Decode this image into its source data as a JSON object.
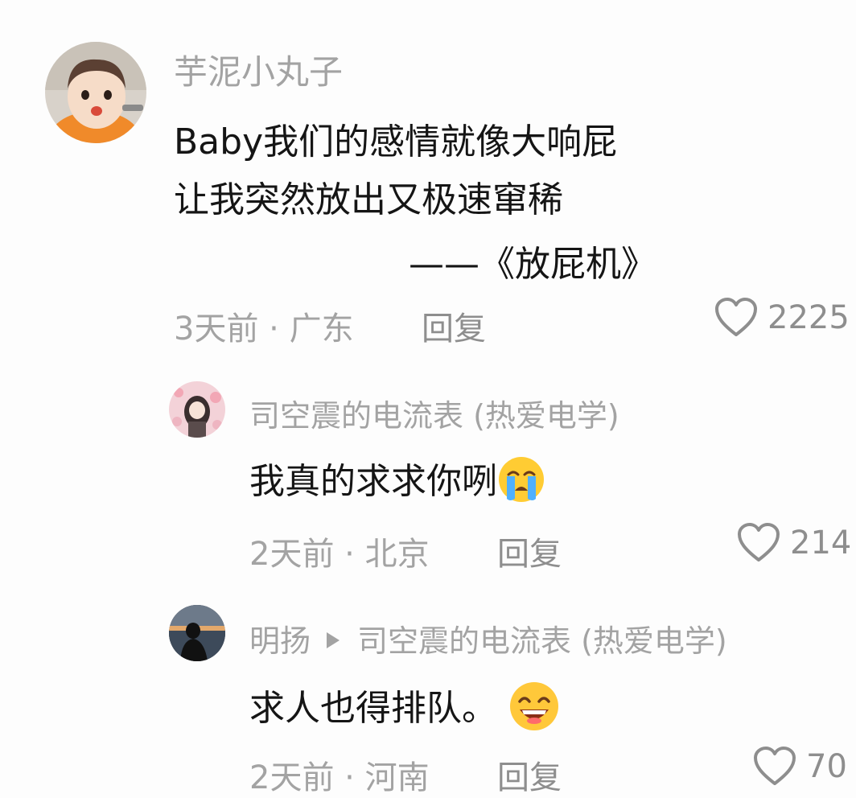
{
  "comments": [
    {
      "username": "芋泥小丸子",
      "lines": [
        "Baby我们的感情就像大响屁",
        "让我突然放出又极速窜稀",
        "——《放屁机》"
      ],
      "time": "3天前",
      "location": "广东",
      "meta_separator": " · ",
      "reply_label": "回复",
      "likes": "2225"
    },
    {
      "username": "司空震的电流表 (热爱电学)",
      "text": "我真的求求你咧",
      "emoji": "crying-face-emoji",
      "time": "2天前",
      "location": "北京",
      "meta_separator": " · ",
      "reply_label": "回复",
      "likes": "214"
    },
    {
      "username": "明扬",
      "reply_to": "司空震的电流表 (热爱电学)",
      "text": "求人也得排队。",
      "emoji": "grinning-face-emoji",
      "time": "2天前",
      "location": "河南",
      "meta_separator": " · ",
      "reply_label": "回复",
      "likes": "70"
    }
  ],
  "colors": {
    "background": "#fdfdfd",
    "text_primary": "#151515",
    "text_secondary": "#a3a3a3",
    "reply_text": "#8e8e8e"
  }
}
